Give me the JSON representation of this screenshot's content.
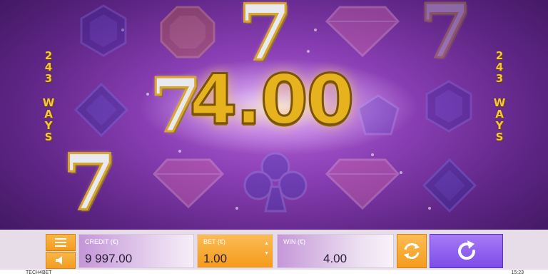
{
  "game": {
    "ways_text": "243 WAYS",
    "win_amount": "4.00"
  },
  "bar": {
    "credit_label": "CREDIT (€)",
    "credit_value": "9 997.00",
    "bet_label": "BET (€)",
    "bet_value": "1.00",
    "win_label": "WIN (€)",
    "win_value": "4.00"
  },
  "footer": {
    "brand": "TECH4BET",
    "time": "15:23"
  },
  "icons": {
    "menu": "menu-icon",
    "sound": "speaker-icon",
    "autoplay": "autoplay-icon",
    "spin": "spin-icon"
  },
  "colors": {
    "accent_orange": "#f59a1b",
    "spin_purple": "#7d4de8",
    "gold": "#e6b21e"
  }
}
